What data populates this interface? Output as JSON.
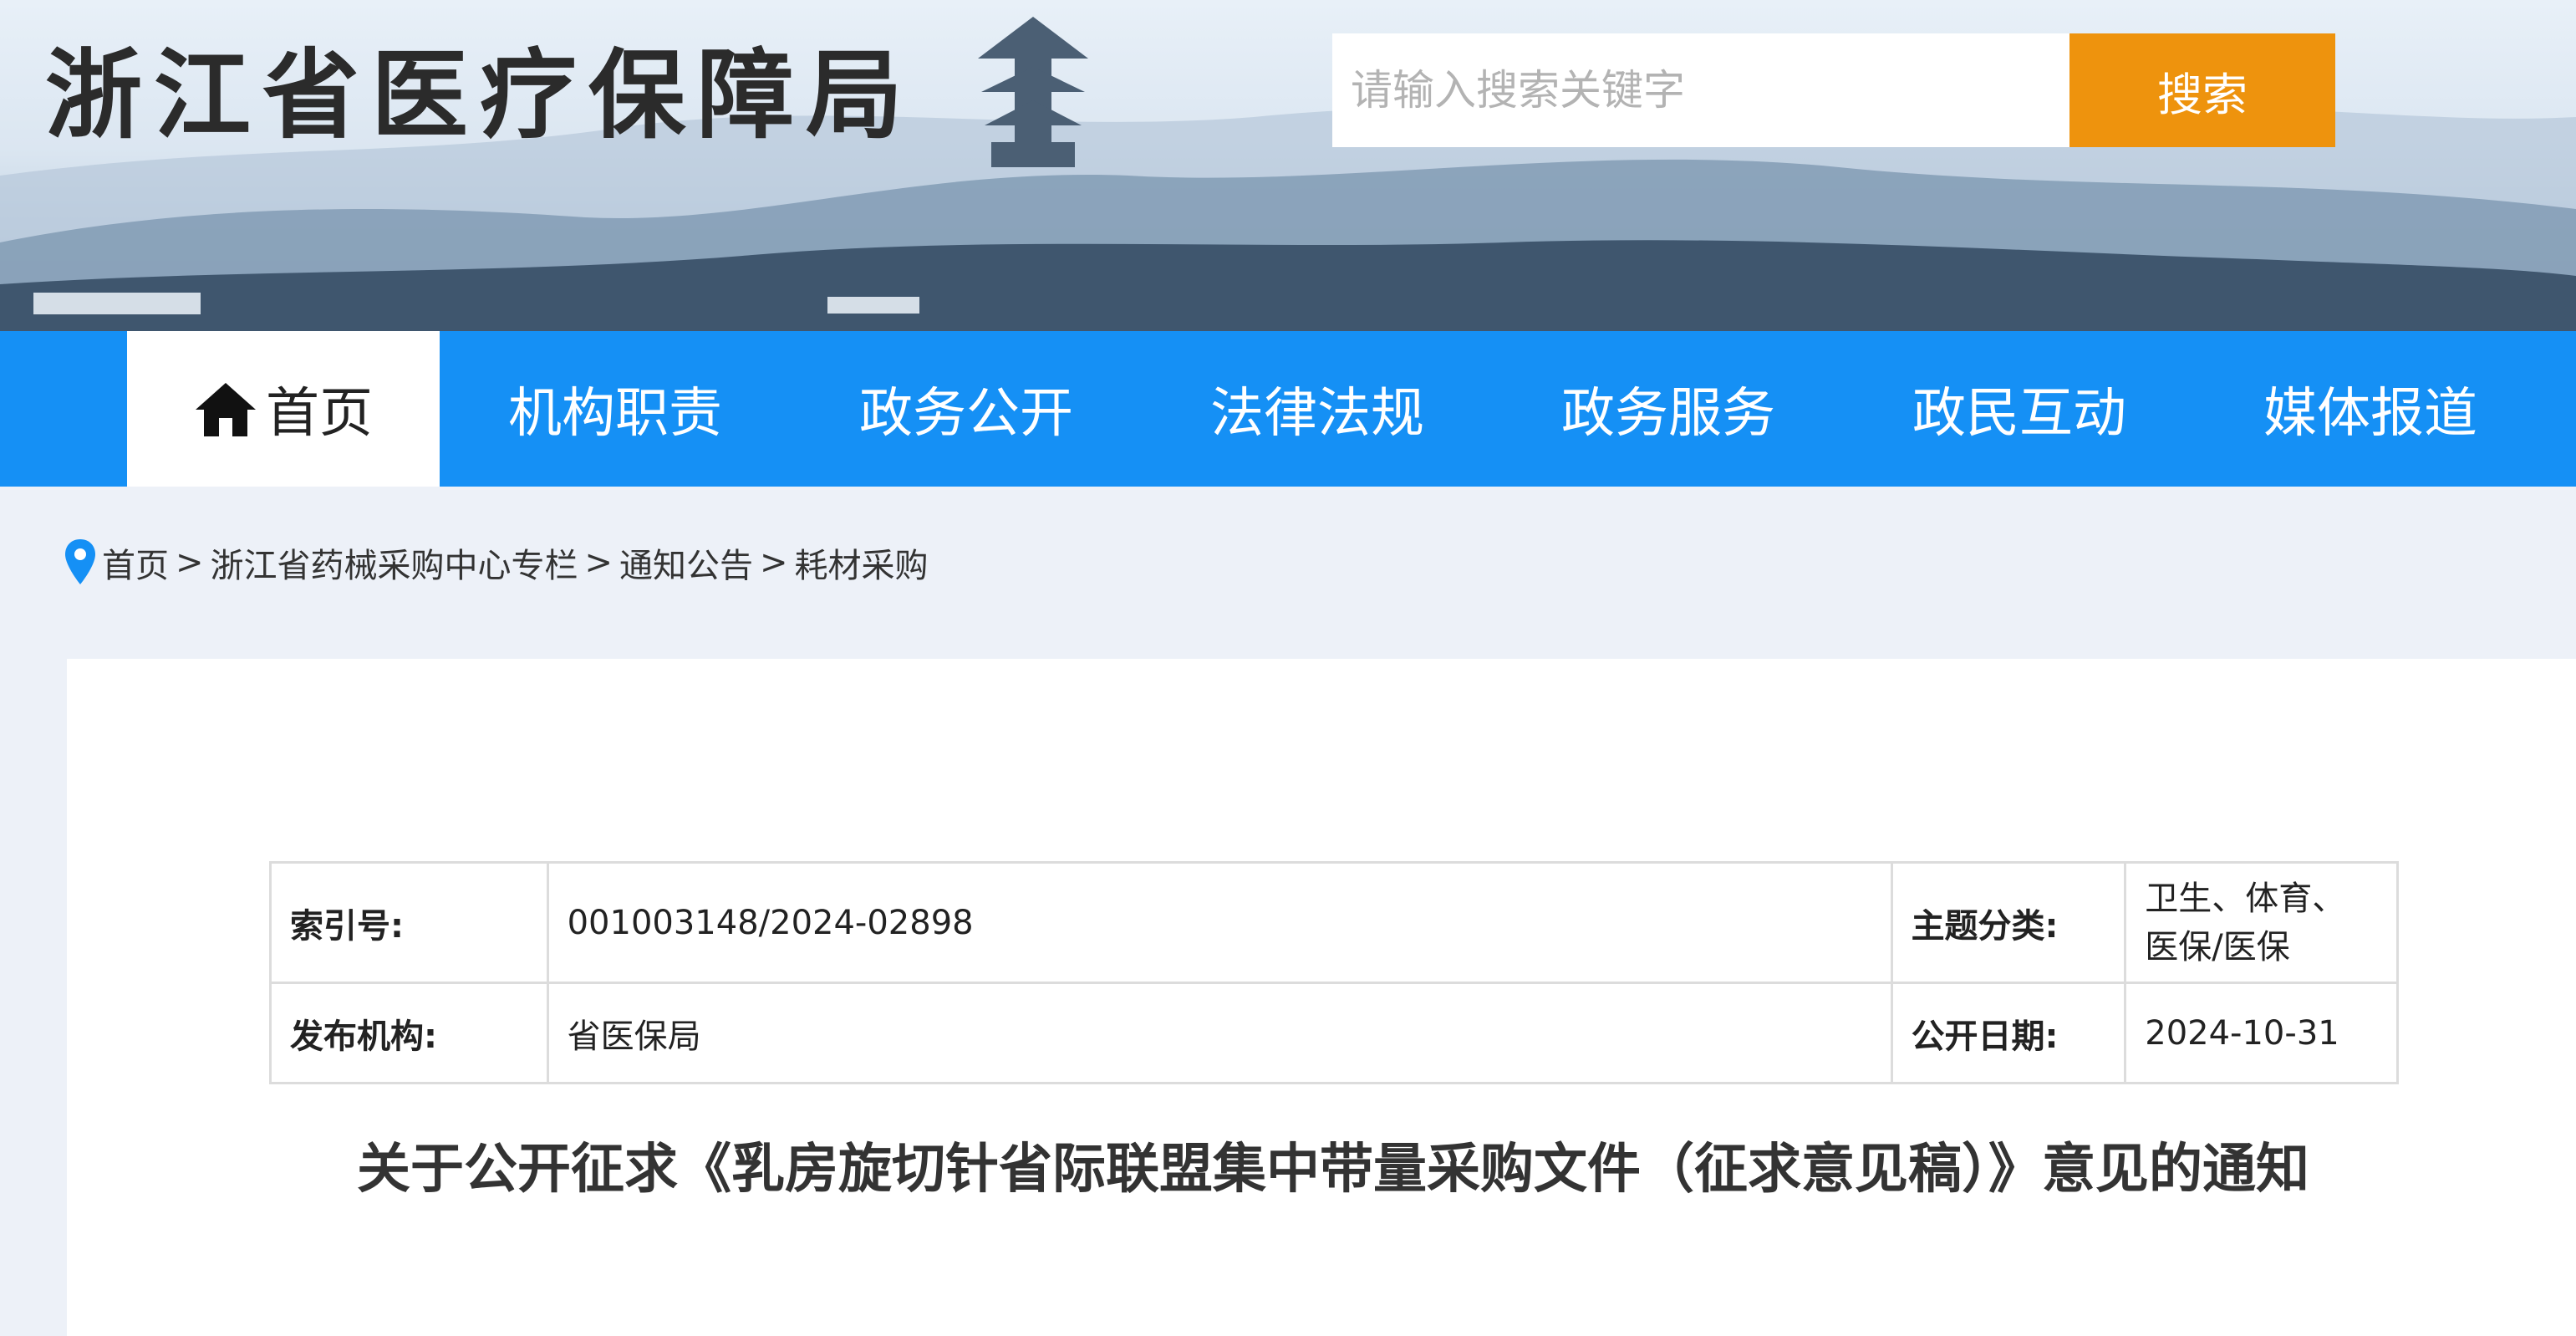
{
  "header": {
    "site_title": "浙江省医疗保障局",
    "search_placeholder": "请输入搜索关键字",
    "search_button": "搜索"
  },
  "nav": {
    "items": [
      {
        "label": "首页",
        "icon": "home-icon",
        "active": true
      },
      {
        "label": "机构职责"
      },
      {
        "label": "政务公开"
      },
      {
        "label": "法律法规"
      },
      {
        "label": "政务服务"
      },
      {
        "label": "政民互动"
      },
      {
        "label": "媒体报道"
      }
    ],
    "bar_color": "#1590f5"
  },
  "breadcrumb": {
    "icon": "location-pin-icon",
    "items": [
      "首页",
      "浙江省药械采购中心专栏",
      "通知公告",
      "耗材采购"
    ],
    "separator": ">"
  },
  "meta": {
    "index_label": "索引号:",
    "index_value": "001003148/2024-02898",
    "topic_label": "主题分类:",
    "topic_value": "卫生、体育、医保/医保",
    "publisher_label": "发布机构:",
    "publisher_value": "省医保局",
    "date_label": "公开日期:",
    "date_value": "2024-10-31"
  },
  "article": {
    "title": "关于公开征求《乳房旋切针省际联盟集中带量采购文件（征求意见稿）》意见的通知"
  },
  "colors": {
    "search_button": "#ee930d",
    "page_background": "#edf1f8"
  }
}
